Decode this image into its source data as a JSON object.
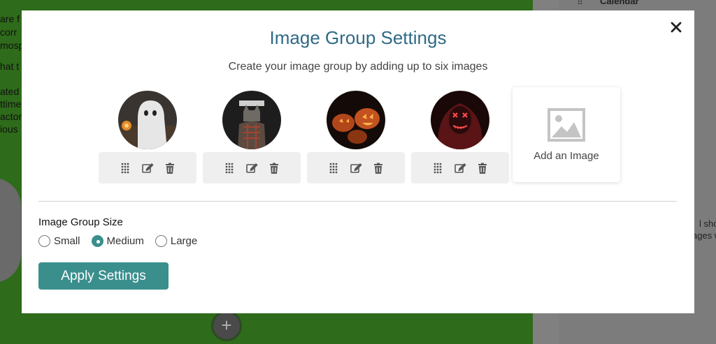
{
  "background": {
    "text_lines": [
      "are f",
      "corr",
      "mosp",
      "hat t",
      "ated l",
      "ttime",
      "actor",
      "ious"
    ],
    "right_panel_text": [
      "Calendar",
      "l sho",
      "ages w"
    ]
  },
  "modal": {
    "title": "Image Group Settings",
    "subtitle": "Create your image group by adding up to six images",
    "images": [
      {
        "icon": "ghost-photo"
      },
      {
        "icon": "werewolf-photo"
      },
      {
        "icon": "pumpkins-photo"
      },
      {
        "icon": "masked-figure-photo"
      }
    ],
    "add_image": {
      "label": "Add an Image",
      "icon": "image-placeholder-icon"
    },
    "group_size": {
      "label": "Image Group Size",
      "options": [
        {
          "label": "Small",
          "selected": false
        },
        {
          "label": "Medium",
          "selected": true
        },
        {
          "label": "Large",
          "selected": false
        }
      ]
    },
    "apply_label": "Apply Settings"
  },
  "colors": {
    "accent": "#3a8f8d",
    "title": "#2f6a85",
    "background_green": "#2e6b1a"
  }
}
